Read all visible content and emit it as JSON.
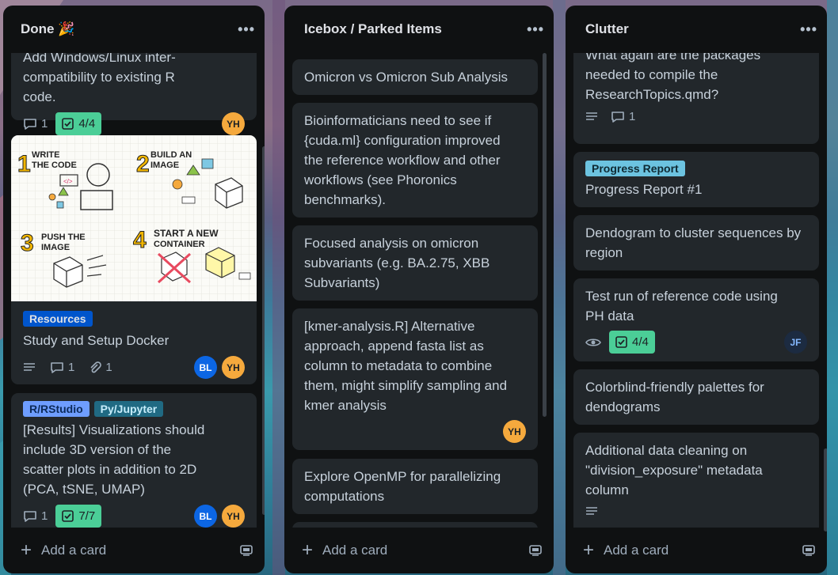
{
  "board": {
    "background_colors": [
      "#7a6a88",
      "#3a9aac",
      "#27677f"
    ]
  },
  "lists": {
    "done": {
      "title": "Done 🎉",
      "menu_label": "•••",
      "add_card_label": "Add a card",
      "cards": {
        "windows": {
          "text": "Add Windows/Linux inter-compatibility to existing R code.",
          "comments": "1",
          "checklist": "4/4",
          "members": [
            "YH"
          ]
        },
        "docker": {
          "cover_texts": {
            "step1": "1",
            "step1a": "WRITE",
            "step1b": "THE CODE",
            "step2": "2",
            "step2a": "BUILD AN",
            "step2b": "IMAGE",
            "step3": "3",
            "step3a": "PUSH THE",
            "step3b": "IMAGE",
            "step4": "4",
            "step4a": "START A NEW",
            "step4b": "CONTAINER"
          },
          "label": "Resources",
          "text": "Study and Setup Docker",
          "comments": "1",
          "attachments": "1",
          "members": [
            "BL",
            "YH"
          ]
        },
        "results": {
          "labels": [
            "R/RStudio",
            "Py/Jupyter"
          ],
          "text": "[Results] Visualizations should include 3D version of the scatter plots in addition to 2D (PCA, tSNE, UMAP)",
          "comments": "1",
          "checklist": "7/7",
          "members": [
            "BL",
            "YH"
          ]
        }
      }
    },
    "icebox": {
      "title": "Icebox / Parked Items",
      "menu_label": "•••",
      "add_card_label": "Add a card",
      "cards": {
        "omicron": {
          "text": "Omicron vs Omicron Sub Analysis"
        },
        "bioinf": {
          "text": "Bioinformaticians need to see if {cuda.ml} configuration improved the reference workflow and other workflows (see Phoronics benchmarks)."
        },
        "focused": {
          "text": "Focused analysis on omicron subvariants (e.g. BA.2.75, XBB Subvariants)"
        },
        "kmer": {
          "text": "[kmer-analysis.R] Alternative approach, append fasta list as column to metadata to combine them, might simplify sampling and kmer analysis",
          "members": [
            "YH"
          ]
        },
        "openmp": {
          "text": "Explore OpenMP for parallelizing computations"
        }
      }
    },
    "clutter": {
      "title": "Clutter",
      "menu_label": "•••",
      "add_card_label": "Add a card",
      "cards": {
        "packages": {
          "text": "What again are the packages needed to compile the ResearchTopics.qmd?",
          "comments": "1"
        },
        "progress": {
          "label": "Progress Report",
          "text": "Progress Report #1"
        },
        "dendogram": {
          "text": "Dendogram to cluster sequences by region"
        },
        "testrun": {
          "text": "Test run of reference code using PH data",
          "checklist": "4/4",
          "members": [
            "JF"
          ]
        },
        "colorblind": {
          "text": "Colorblind-friendly palettes for dendograms"
        },
        "cleaning": {
          "text": "Additional data cleaning on \"division_exposure\" metadata column"
        }
      }
    }
  }
}
